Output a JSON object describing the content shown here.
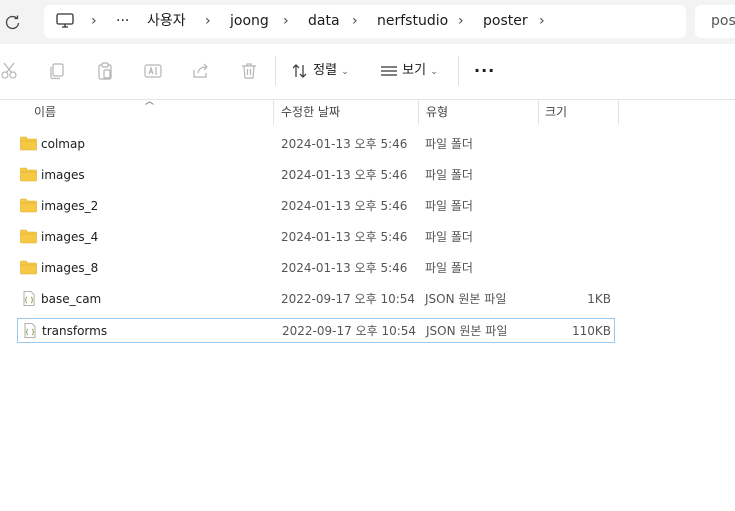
{
  "address_bar": {
    "crumbs": [
      "사용자",
      "joong",
      "data",
      "nerfstudio",
      "poster"
    ],
    "ellipsis": "···"
  },
  "search": {
    "placeholder": "post"
  },
  "toolbar": {
    "sort_label": "정렬",
    "view_label": "보기",
    "more_label": "···"
  },
  "columns": {
    "name": "이름",
    "date": "수정한 날짜",
    "type": "유형",
    "size": "크기"
  },
  "files": [
    {
      "name": "colmap",
      "date": "2024-01-13 오후 5:46",
      "type": "파일 폴더",
      "size": "",
      "kind": "folder"
    },
    {
      "name": "images",
      "date": "2024-01-13 오후 5:46",
      "type": "파일 폴더",
      "size": "",
      "kind": "folder"
    },
    {
      "name": "images_2",
      "date": "2024-01-13 오후 5:46",
      "type": "파일 폴더",
      "size": "",
      "kind": "folder"
    },
    {
      "name": "images_4",
      "date": "2024-01-13 오후 5:46",
      "type": "파일 폴더",
      "size": "",
      "kind": "folder"
    },
    {
      "name": "images_8",
      "date": "2024-01-13 오후 5:46",
      "type": "파일 폴더",
      "size": "",
      "kind": "folder"
    },
    {
      "name": "base_cam",
      "date": "2022-09-17 오후 10:54",
      "type": "JSON 원본 파일",
      "size": "1KB",
      "kind": "json"
    },
    {
      "name": "transforms",
      "date": "2022-09-17 오후 10:54",
      "type": "JSON 원본 파일",
      "size": "110KB",
      "kind": "json",
      "selected": true
    }
  ],
  "colors": {
    "folder": "#f6c945",
    "selection_border": "#99c9ef",
    "topbar": "#f3f3f3"
  }
}
